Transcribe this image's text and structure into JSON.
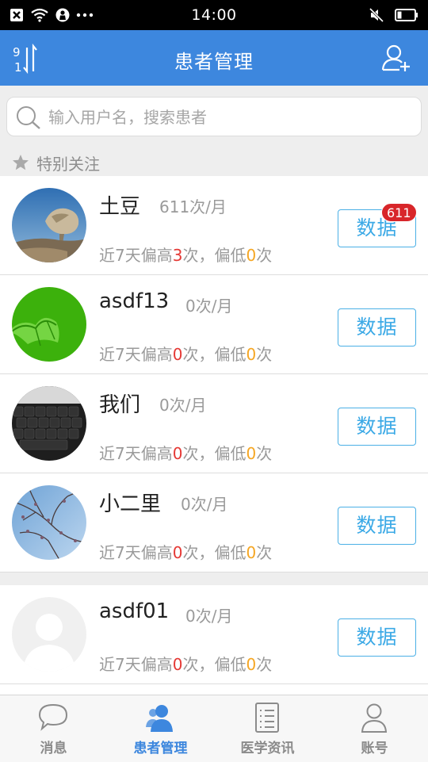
{
  "status_bar": {
    "time": "14:00"
  },
  "header": {
    "title": "患者管理",
    "sort_digits_top": "9",
    "sort_digits_bottom": "1"
  },
  "search": {
    "placeholder": "输入用户名，搜索患者",
    "value": ""
  },
  "section": {
    "label": "特别关注"
  },
  "patients": [
    {
      "name": "土豆",
      "frequency": "611次/月",
      "stats_prefix": "近7天偏高",
      "high": "3",
      "stats_middle": "次，偏低",
      "low": "0",
      "stats_suffix": "次",
      "button_label": "数据",
      "badge": "611",
      "avatar": "rock-photo"
    },
    {
      "name": "asdf13",
      "frequency": "0次/月",
      "stats_prefix": "近7天偏高",
      "high": "0",
      "stats_middle": "次，偏低",
      "low": "0",
      "stats_suffix": "次",
      "button_label": "数据",
      "avatar": "green-umbrella"
    },
    {
      "name": "我们",
      "frequency": "0次/月",
      "stats_prefix": "近7天偏高",
      "high": "0",
      "stats_middle": "次，偏低",
      "low": "0",
      "stats_suffix": "次",
      "button_label": "数据",
      "avatar": "keyboard-photo"
    },
    {
      "name": "小二里",
      "frequency": "0次/月",
      "stats_prefix": "近7天偏高",
      "high": "0",
      "stats_middle": "次，偏低",
      "low": "0",
      "stats_suffix": "次",
      "button_label": "数据",
      "avatar": "blossom-photo"
    },
    {
      "name": "asdf01",
      "frequency": "0次/月",
      "stats_prefix": "近7天偏高",
      "high": "0",
      "stats_middle": "次，偏低",
      "low": "0",
      "stats_suffix": "次",
      "button_label": "数据",
      "avatar": "default-avatar"
    }
  ],
  "bottom_nav": [
    {
      "label": "消息",
      "icon": "chat-bubble-icon",
      "active": false
    },
    {
      "label": "患者管理",
      "icon": "patients-icon",
      "active": true
    },
    {
      "label": "医学资讯",
      "icon": "document-icon",
      "active": false
    },
    {
      "label": "账号",
      "icon": "person-icon",
      "active": false
    }
  ],
  "colors": {
    "header_bg": "#3d87de",
    "accent": "#3ba9e6",
    "high_value": "#e53935",
    "low_value": "#f5a623",
    "badge": "#d8262a"
  }
}
